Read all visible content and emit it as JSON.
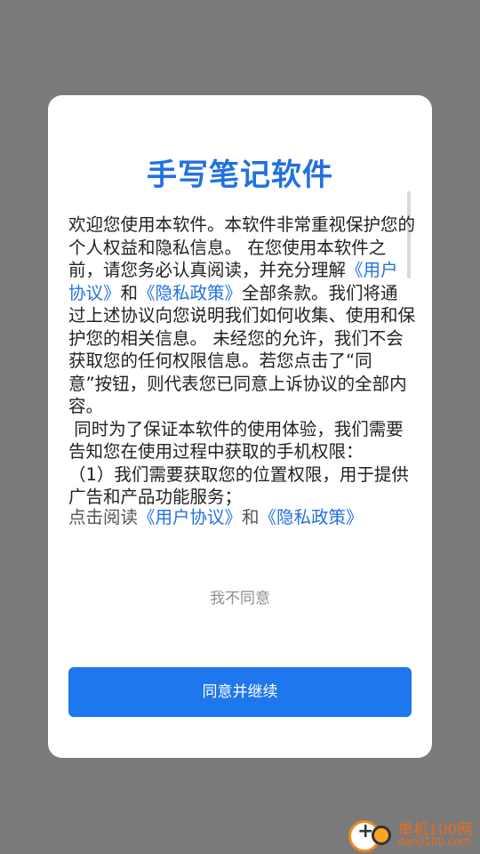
{
  "dialog": {
    "title": "手写笔记软件",
    "body": {
      "p1_before": "欢迎您使用本软件。本软件非常重视保护您的个人权益和隐私信息。 在您使用本软件之前，请您务必认真阅读，并充分理解",
      "link_user": "《用户协议》",
      "and": "和",
      "link_privacy": "《隐私政策》",
      "p1_after": "全部条款。我们将通过上述协议向您说明我们如何收集、使用和保护您的相关信息。 未经您的允许，我们不会获取您的任何权限信息。若您点击了“同意”按钮，则代表您已同意上诉协议的全部内容。\n 同时为了保证本软件的使用体验，我们需要告知您在使用过程中获取的手机权限：\n（1）我们需要获取您的位置权限，用于提供广告和产品功能服务；"
    },
    "read_line": {
      "prefix": "点击阅读",
      "link_user": "《用户协议》",
      "and": "和",
      "link_privacy": "《隐私政策》"
    },
    "disagree_label": "我不同意",
    "agree_label": "同意并继续"
  },
  "watermark": {
    "name": "单机100网",
    "url": "danji100.com"
  },
  "colors": {
    "accent": "#2371e0",
    "button": "#1e77ec",
    "overlay": "#7a7a7a"
  }
}
